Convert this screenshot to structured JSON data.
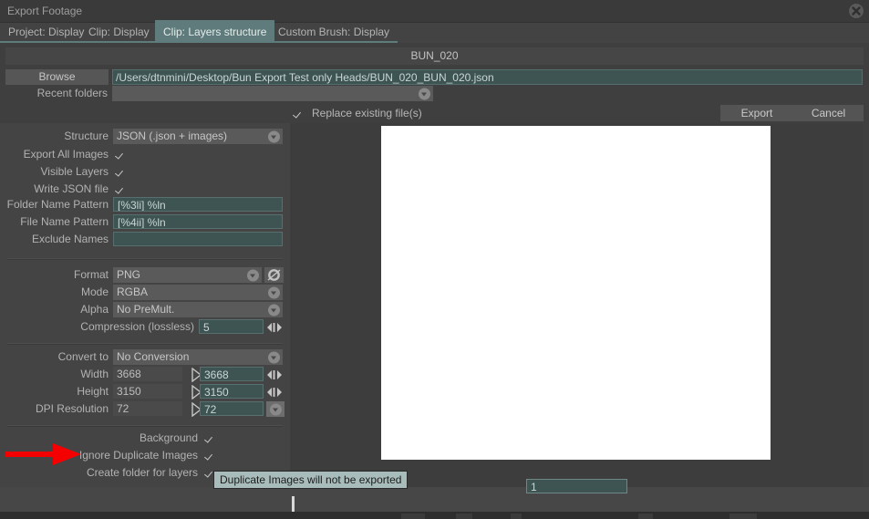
{
  "window": {
    "title": "Export Footage",
    "close_icon": "close-circle-icon"
  },
  "tabs": [
    {
      "label": "Project: Display",
      "active": false
    },
    {
      "label": "Clip: Display",
      "active": false
    },
    {
      "label": "Clip: Layers structure",
      "active": true
    },
    {
      "label": "Custom Brush: Display",
      "active": false
    }
  ],
  "header": {
    "clip_name": "BUN_020",
    "browse_label": "Browse",
    "path_value": "/Users/dtnmini/Desktop/Bun Export Test only Heads/BUN_020_BUN_020.json",
    "recent_folders_label": "Recent folders",
    "recent_folders_value": "",
    "replace_label": "Replace existing file(s)",
    "replace_checked": true,
    "export_label": "Export",
    "cancel_label": "Cancel"
  },
  "settings": {
    "structure_label": "Structure",
    "structure_value": "JSON (.json + images)",
    "export_all_images_label": "Export All Images",
    "export_all_images_checked": true,
    "visible_layers_label": "Visible Layers",
    "visible_layers_checked": true,
    "write_json_label": "Write JSON file",
    "write_json_checked": true,
    "folder_pattern_label": "Folder Name Pattern",
    "folder_pattern_value": "[%3li] %ln",
    "file_pattern_label": "File Name Pattern",
    "file_pattern_value": "[%4ii] %ln",
    "exclude_names_label": "Exclude Names",
    "exclude_names_value": "",
    "format_label": "Format",
    "format_value": "PNG",
    "mode_label": "Mode",
    "mode_value": "RGBA",
    "alpha_label": "Alpha",
    "alpha_value": "No PreMult.",
    "compression_label": "Compression (lossless)",
    "compression_value": "5",
    "convert_label": "Convert to",
    "convert_value": "No Conversion",
    "width_label": "Width",
    "width_source": "3668",
    "width_target": "3668",
    "height_label": "Height",
    "height_source": "3150",
    "height_target": "3150",
    "dpi_label": "DPI Resolution",
    "dpi_source": "72",
    "dpi_target": "72",
    "background_label": "Background",
    "background_checked": true,
    "ignore_duplicate_label": "Ignore Duplicate Images",
    "ignore_duplicate_checked": true,
    "create_folder_label": "Create folder for layers",
    "create_folder_checked": true
  },
  "tooltip": {
    "text": "Duplicate Images will not be exported"
  },
  "bottom": {
    "number_value": "1"
  },
  "colors": {
    "window_bg": "#3f3f3f",
    "panel_bg": "#444444",
    "field_teal": "#3e5453",
    "tab_active": "#5f7b7b",
    "tab_underline": "#5d7d7d",
    "text": "#b2b2b2",
    "annotation_red": "#f40000",
    "tooltip_bg": "#a8bdbb",
    "preview_white": "#ffffff"
  }
}
